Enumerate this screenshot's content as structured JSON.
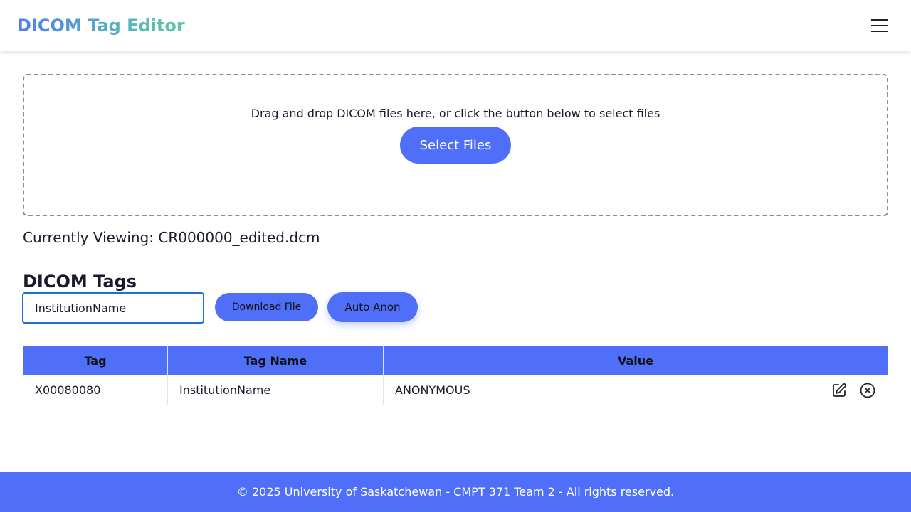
{
  "header": {
    "title": "DICOM Tag Editor",
    "menu_icon": "hamburger-menu-icon"
  },
  "dropzone": {
    "instructions": "Drag and drop DICOM files here, or click the button below to select files",
    "select_button_label": "Select Files"
  },
  "viewer": {
    "current_file_label": "Currently Viewing: CR000000_edited.dcm"
  },
  "tags_section": {
    "title": "DICOM Tags",
    "search_value": "InstitutionName",
    "download_button_label": "Download File",
    "anon_button_label": "Auto Anon"
  },
  "table": {
    "headers": [
      "Tag",
      "Tag Name",
      "Value"
    ],
    "rows": [
      {
        "tag": "X00080080",
        "name": "InstitutionName",
        "value": "ANONYMOUS",
        "actions": [
          "edit-icon",
          "remove-icon"
        ]
      }
    ]
  },
  "footer": {
    "text": "© 2025 University of Saskatchewan - CMPT 371 Team 2 - All rights reserved."
  },
  "colors": {
    "accent": "#4f6ff8",
    "title_gradient_start": "#4f7ef0",
    "title_gradient_end": "#5cc9a0",
    "input_focus_border": "#1f6fd1",
    "dropzone_border": "#7a8fb0"
  }
}
